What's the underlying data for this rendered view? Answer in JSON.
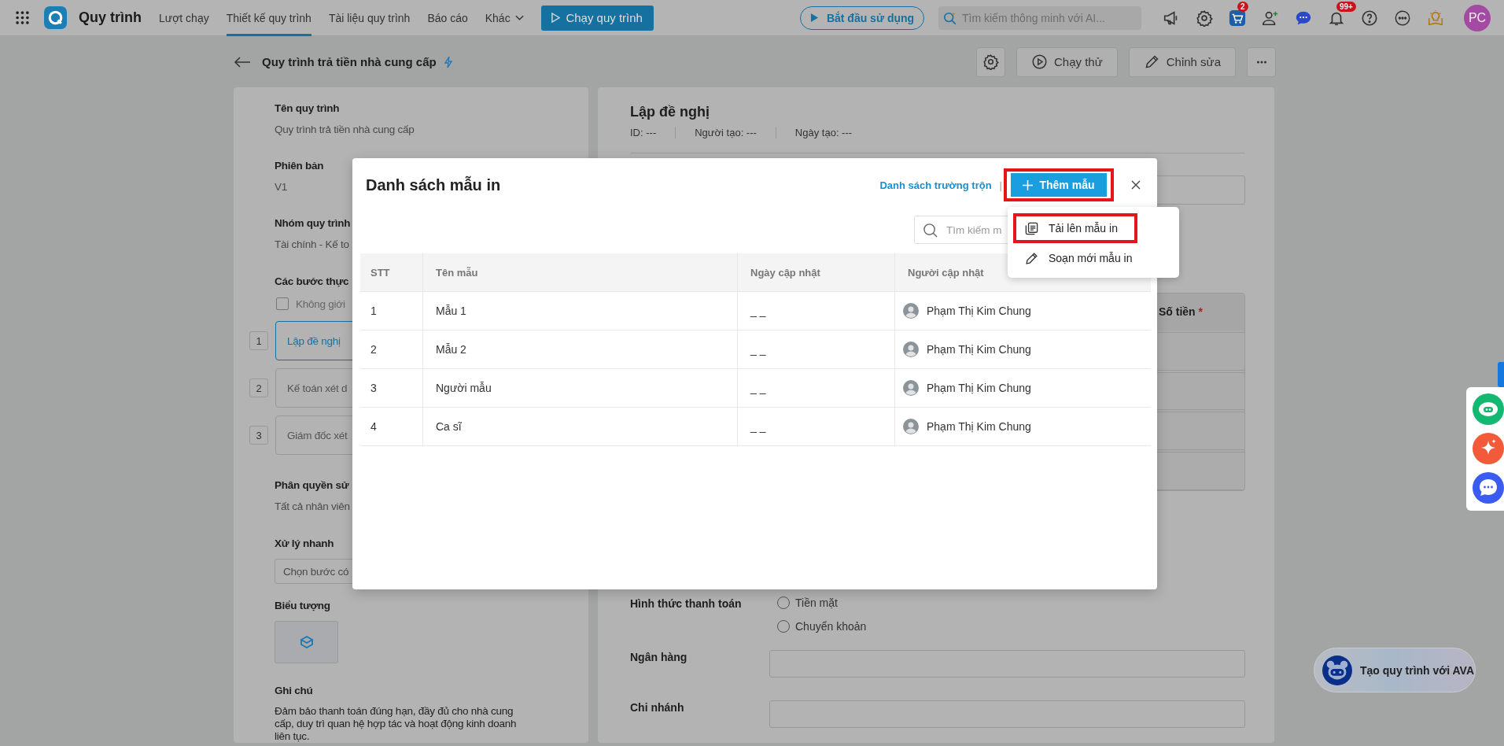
{
  "topbar": {
    "app_name": "Quy trình",
    "nav": [
      {
        "label": "Lượt chạy",
        "selected": false,
        "dropdown": false
      },
      {
        "label": "Thiết kế quy trình",
        "selected": true,
        "dropdown": false
      },
      {
        "label": "Tài liệu quy trình",
        "selected": false,
        "dropdown": false
      },
      {
        "label": "Báo cáo",
        "selected": false,
        "dropdown": false
      },
      {
        "label": "Khác",
        "selected": false,
        "dropdown": true
      }
    ],
    "run_button": "Chạy quy trình",
    "start_button": "Bắt đầu sử dụng",
    "search": {
      "placeholder": "Tìm kiếm thông minh với AI..."
    },
    "tools": [
      {
        "kind": "megaphone"
      },
      {
        "kind": "settings"
      },
      {
        "kind": "cart",
        "badge": "2"
      },
      {
        "kind": "add-user"
      },
      {
        "kind": "chat"
      },
      {
        "kind": "bell",
        "badge": "99+"
      },
      {
        "kind": "help"
      },
      {
        "kind": "more"
      },
      {
        "kind": "lamp"
      }
    ],
    "avatar": "PC"
  },
  "header": {
    "title": "Quy trình trả tiền nhà cung cấp",
    "actions": [
      {
        "kind": "settings"
      },
      {
        "kind": "play",
        "label": "Chạy thử"
      },
      {
        "kind": "edit",
        "label": "Chỉnh sửa"
      },
      {
        "kind": "more"
      }
    ]
  },
  "info_panel": {
    "fields": [
      {
        "label": "Tên quy trình",
        "value": "Quy trình trả tiền nhà cung cấp"
      },
      {
        "label": "Phiên bản",
        "value": "V1"
      },
      {
        "label": "Nhóm quy trình",
        "value": "Tài chính - Kế to"
      }
    ],
    "steps_label": "Các bước thực",
    "no_limit": {
      "label": "Không giới",
      "checked": false
    },
    "steps": [
      {
        "number": "1",
        "label": "Lập đề nghị",
        "selected": true
      },
      {
        "number": "2",
        "label": "Kế toán xét d",
        "selected": false
      },
      {
        "number": "3",
        "label": "Giám đốc xét",
        "selected": false
      }
    ],
    "permission": {
      "label": "Phân quyền sử",
      "value": "Tất cả nhân viên"
    },
    "quick": {
      "label": "Xử lý nhanh",
      "placeholder": "Chọn bước có"
    },
    "icon_label": "Biểu tượng",
    "note": {
      "label": "Ghi chú",
      "value": "Đảm bảo thanh toán đúng hạn, đầy đủ cho nhà cung cấp, duy trì quan hệ hợp tác và hoạt động kinh doanh liên tục."
    }
  },
  "form": {
    "title": "Lập đề nghị",
    "meta": [
      {
        "label": "ID:",
        "value": "---"
      },
      {
        "label": "Người tạo:",
        "value": "---"
      },
      {
        "label": "Ngày tạo:",
        "value": "---"
      }
    ],
    "table_header": {
      "label": "Số tiền",
      "required_mark": "*"
    },
    "payment": {
      "label": "Hình thức thanh toán",
      "options": [
        {
          "label": "Tiền mặt",
          "selected": false
        },
        {
          "label": "Chuyển khoản",
          "selected": false
        }
      ]
    },
    "fields": [
      {
        "label": "Ngân hàng"
      },
      {
        "label": "Chi nhánh"
      }
    ]
  },
  "modal": {
    "title": "Danh sách mẫu in",
    "link": "Danh sách trường trộn",
    "separator": "|",
    "add_button": {
      "label": "Thêm mẫu",
      "highlighted": true
    },
    "search": {
      "placeholder": "Tìm kiếm m"
    },
    "columns": [
      "STT",
      "Tên mẫu",
      "Ngày cập nhật",
      "Người cập nhật"
    ],
    "rows": [
      {
        "stt": "1",
        "name": "Mẫu 1",
        "updated": "_ _",
        "updater": "Phạm Thị Kim Chung"
      },
      {
        "stt": "2",
        "name": "Mẫu 2",
        "updated": "_ _",
        "updater": "Phạm Thị Kim Chung"
      },
      {
        "stt": "3",
        "name": "Người mẫu",
        "updated": "_ _",
        "updater": "Phạm Thị Kim Chung"
      },
      {
        "stt": "4",
        "name": "Ca sĩ",
        "updated": "_ _",
        "updater": "Phạm Thị Kim Chung"
      }
    ],
    "menu": [
      {
        "kind": "upload",
        "label": "Tải lên mẫu in",
        "highlighted": true
      },
      {
        "kind": "edit",
        "label": "Soạn mới mẫu in",
        "highlighted": false
      }
    ]
  },
  "side_widgets": [
    {
      "kind": "bot"
    },
    {
      "kind": "sparkle"
    },
    {
      "kind": "chat"
    }
  ],
  "ava_button": "Tạo quy trình với AVA"
}
